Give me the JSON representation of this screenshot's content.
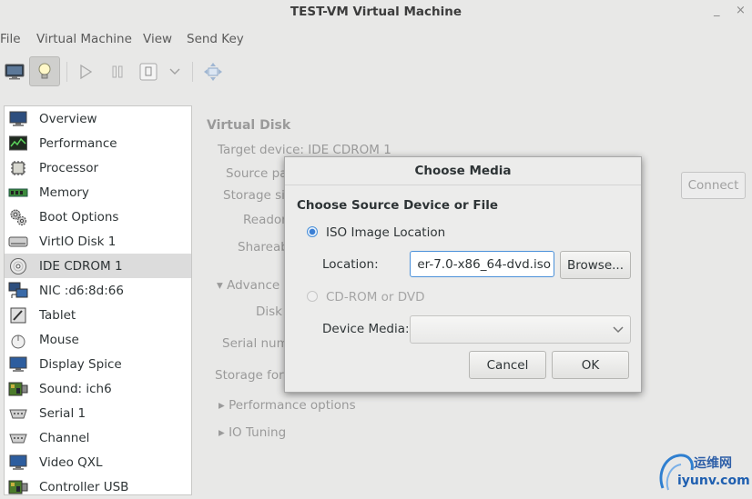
{
  "window": {
    "title": "TEST-VM Virtual Machine"
  },
  "menu": [
    "File",
    "Virtual Machine",
    "View",
    "Send Key"
  ],
  "toolbar": {
    "buttons": [
      "monitor-icon",
      "lightbulb-icon",
      "play-icon",
      "pause-icon",
      "power-icon",
      "chevron-down-icon",
      "fullscreen-icon"
    ]
  },
  "sidebar": {
    "items": [
      {
        "label": "Overview",
        "icon": "overview-monitor-icon"
      },
      {
        "label": "Performance",
        "icon": "performance-graph-icon"
      },
      {
        "label": "Processor",
        "icon": "processor-chip-icon"
      },
      {
        "label": "Memory",
        "icon": "memory-module-icon"
      },
      {
        "label": "Boot Options",
        "icon": "boot-gears-icon"
      },
      {
        "label": "VirtIO Disk 1",
        "icon": "hard-disk-icon"
      },
      {
        "label": "IDE CDROM 1",
        "icon": "cdrom-disc-icon"
      },
      {
        "label": "NIC :d6:8d:66",
        "icon": "network-icon"
      },
      {
        "label": "Tablet",
        "icon": "tablet-icon"
      },
      {
        "label": "Mouse",
        "icon": "mouse-icon"
      },
      {
        "label": "Display Spice",
        "icon": "display-monitor-icon"
      },
      {
        "label": "Sound: ich6",
        "icon": "sound-card-icon"
      },
      {
        "label": "Serial 1",
        "icon": "serial-port-icon"
      },
      {
        "label": "Channel",
        "icon": "channel-port-icon"
      },
      {
        "label": "Video QXL",
        "icon": "video-monitor-icon"
      },
      {
        "label": "Controller USB",
        "icon": "controller-card-icon"
      }
    ],
    "selected_index": 6
  },
  "details": {
    "section_title": "Virtual Disk",
    "target_device": "Target device:  IDE CDROM 1",
    "source_path": "Source pa",
    "storage_size": "Storage si",
    "readonly": "Readon",
    "shareable": "Shareab",
    "advanced": "Advance",
    "disk": "Disk",
    "serial_number": "Serial num",
    "storage_format": "Storage for",
    "performance_options": "Performance options",
    "io_tuning": "IO Tuning",
    "connect_button": "Connect"
  },
  "dialog": {
    "title": "Choose Media",
    "heading": "Choose Source Device or File",
    "iso_option": "ISO Image Location",
    "location_label": "Location:",
    "location_value": "er-7.0-x86_64-dvd.iso",
    "browse_button": "Browse...",
    "cdrom_option": "CD-ROM or DVD",
    "device_media_label": "Device Media:",
    "device_media_value": "",
    "cancel_button": "Cancel",
    "ok_button": "OK"
  },
  "watermark": {
    "text_cn": "运维网",
    "text_url": "iyunv.com"
  }
}
